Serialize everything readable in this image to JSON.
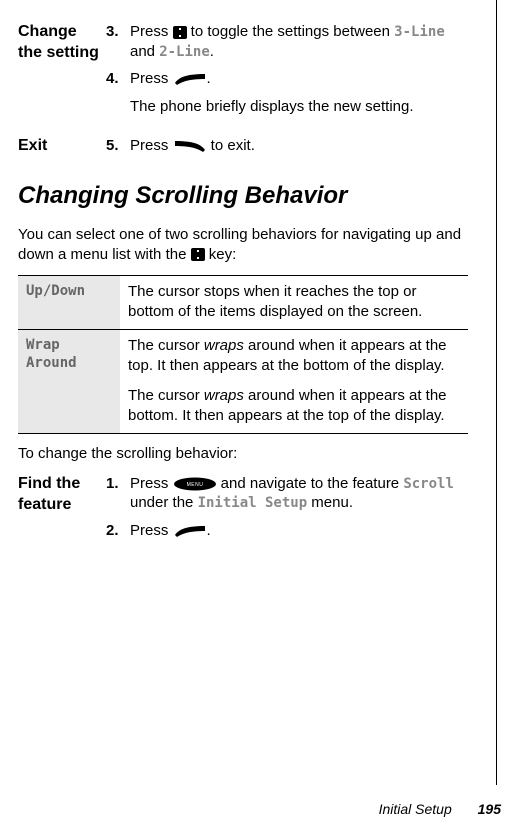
{
  "steps_top": [
    {
      "label": "Change the setting",
      "items": [
        {
          "num": "3.",
          "pre": "Press ",
          "icon": "nav",
          "between": " to toggle the settings between ",
          "mono1": "3-Line",
          "and": " and ",
          "mono2": "2-Line",
          "post": "."
        },
        {
          "num": "4.",
          "pre": "Press ",
          "icon": "select",
          "post": "."
        }
      ],
      "extra": "The phone briefly displays the new setting."
    },
    {
      "label": "Exit",
      "items": [
        {
          "num": "5.",
          "pre": "Press ",
          "icon": "back",
          "post": " to exit."
        }
      ]
    }
  ],
  "heading": "Changing Scrolling Behavior",
  "intro_pre": "You can select one of two scrolling behaviors for navigating up and down a menu list with the ",
  "intro_post": " key:",
  "options": [
    {
      "name": "Up/Down",
      "desc1_a": "The cursor stops when it reaches the top or bottom of the items displayed on the screen."
    },
    {
      "name": "Wrap Around",
      "desc1_a": "The cursor ",
      "desc1_i": "wraps",
      "desc1_b": " around when it appears at the top. It then appears at the bottom of the display.",
      "desc2_a": "The cursor ",
      "desc2_i": "wraps",
      "desc2_b": " around when it appears at the bottom. It then appears at the top of the display."
    }
  ],
  "lead2": "To change the scrolling behavior:",
  "steps_bottom": {
    "label": "Find the feature",
    "items": [
      {
        "num": "1.",
        "pre": "Press ",
        "icon": "menu",
        "between": " and navigate to the feature ",
        "mono1": "Scroll",
        "mid": " under the ",
        "mono2": "Initial Setup",
        "post": " menu."
      },
      {
        "num": "2.",
        "pre": "Press ",
        "icon": "select",
        "post": "."
      }
    ]
  },
  "footer": {
    "section": "Initial Setup",
    "page": "195"
  }
}
